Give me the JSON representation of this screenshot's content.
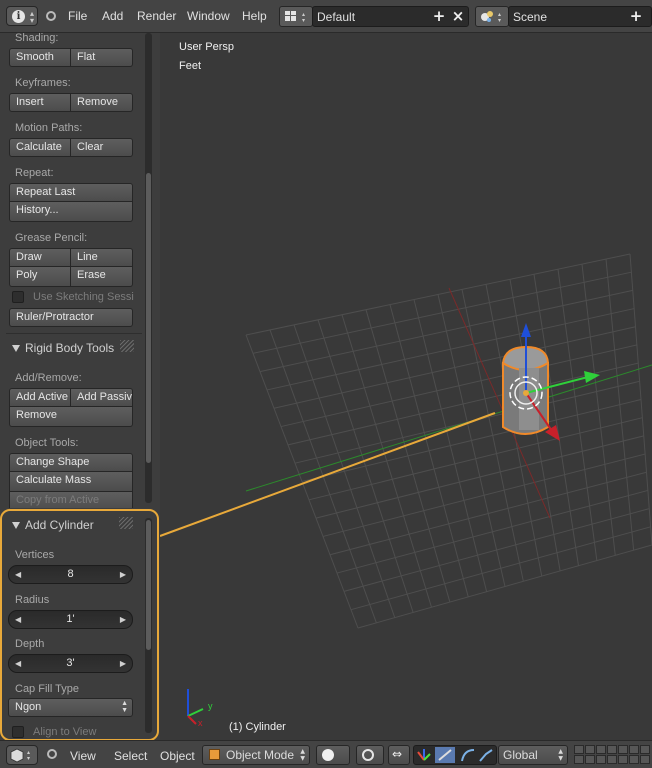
{
  "topbar": {
    "menus": [
      "File",
      "Add",
      "Render",
      "Window",
      "Help"
    ],
    "screen_layout": "Default",
    "scene": "Scene"
  },
  "shelf": {
    "shading": {
      "label": "Shading:",
      "smooth": "Smooth",
      "flat": "Flat"
    },
    "keyframes": {
      "label": "Keyframes:",
      "insert": "Insert",
      "remove": "Remove"
    },
    "motion_paths": {
      "label": "Motion Paths:",
      "calculate": "Calculate",
      "clear": "Clear"
    },
    "repeat": {
      "label": "Repeat:",
      "repeat_last": "Repeat Last",
      "history": "History..."
    },
    "grease_pencil": {
      "label": "Grease Pencil:",
      "draw": "Draw",
      "line": "Line",
      "poly": "Poly",
      "erase": "Erase",
      "use_sketching": "Use Sketching Sessi",
      "ruler": "Ruler/Protractor"
    },
    "rigid_body": {
      "title": "Rigid Body Tools",
      "add_remove_label": "Add/Remove:",
      "add_active": "Add Active",
      "add_passive": "Add Passiv",
      "remove": "Remove",
      "object_tools_label": "Object Tools:",
      "change_shape": "Change Shape",
      "calculate_mass": "Calculate Mass",
      "copy_from_active": "Copy from Active"
    }
  },
  "operator": {
    "title": "Add Cylinder",
    "vertices_label": "Vertices",
    "vertices_value": "8",
    "radius_label": "Radius",
    "radius_value": "1'",
    "depth_label": "Depth",
    "depth_value": "3'",
    "cap_fill_label": "Cap Fill Type",
    "cap_fill_value": "Ngon",
    "align_to_view": "Align to View"
  },
  "viewport": {
    "view_name": "User Persp",
    "units": "Feet",
    "selected_object": "(1) Cylinder",
    "axis_x": "x",
    "axis_y": "y"
  },
  "bottombar": {
    "view": "View",
    "select": "Select",
    "object": "Object",
    "mode": "Object Mode",
    "orientation": "Global"
  },
  "colors": {
    "highlight": "#e8a93a",
    "selection_outline": "#f08a2a",
    "axis_x": "#c8202a",
    "axis_y": "#2fd03a",
    "axis_z": "#1f4fd8"
  }
}
